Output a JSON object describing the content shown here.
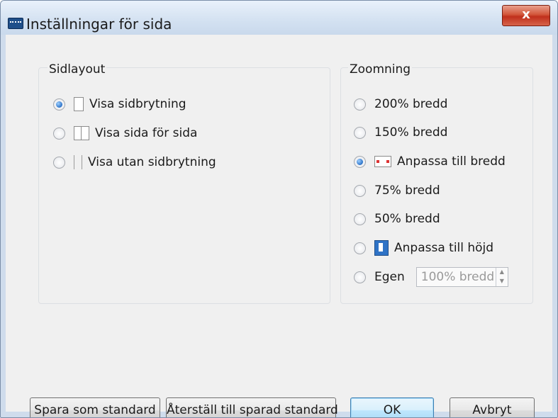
{
  "window": {
    "title": "Inställningar för sida",
    "close_label": "x"
  },
  "layout_group": {
    "label": "Sidlayout",
    "options": [
      {
        "label": "Visa sidbrytning",
        "checked": true,
        "icon": "single-page-icon"
      },
      {
        "label": "Visa sida för sida",
        "checked": false,
        "icon": "two-page-icon"
      },
      {
        "label": "Visa utan sidbrytning",
        "checked": false,
        "icon": "continuous-page-icon"
      }
    ]
  },
  "zoom_group": {
    "label": "Zoomning",
    "options": [
      {
        "label": "200% bredd",
        "checked": false
      },
      {
        "label": "150% bredd",
        "checked": false
      },
      {
        "label": "Anpassa till bredd",
        "checked": true,
        "icon": "fit-width-icon"
      },
      {
        "label": "75% bredd",
        "checked": false
      },
      {
        "label": "50% bredd",
        "checked": false
      },
      {
        "label": "Anpassa till höjd",
        "checked": false,
        "icon": "fit-height-icon"
      },
      {
        "label": "Egen",
        "checked": false
      }
    ],
    "custom_value": "100% bredd"
  },
  "buttons": {
    "save_default": "Spara som standard",
    "restore_default": "Återställ till sparad standard",
    "ok": "OK",
    "cancel": "Avbryt"
  }
}
